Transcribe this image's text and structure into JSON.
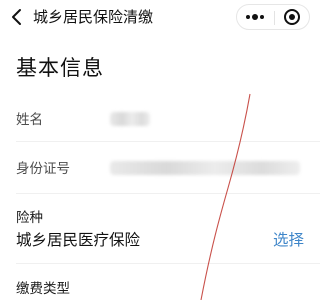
{
  "navbar": {
    "title": "城乡居民保险清缴",
    "back_icon": "chevron-left-icon",
    "more_icon": "more-dots-icon",
    "close_icon": "miniprogram-close-icon"
  },
  "basic_info": {
    "section_title": "基本信息",
    "name_label": "姓名",
    "id_label": "身份证号",
    "insurance_type_label": "险种",
    "insurance_type_value": "城乡居民医疗保险",
    "select_label": "选择",
    "payment_type_label": "缴费类型"
  },
  "colors": {
    "link": "#3f86c9",
    "text_primary": "#111111",
    "text_secondary": "#4d4d4d",
    "divider": "#f0f0f0",
    "crack": "#c0322b"
  }
}
